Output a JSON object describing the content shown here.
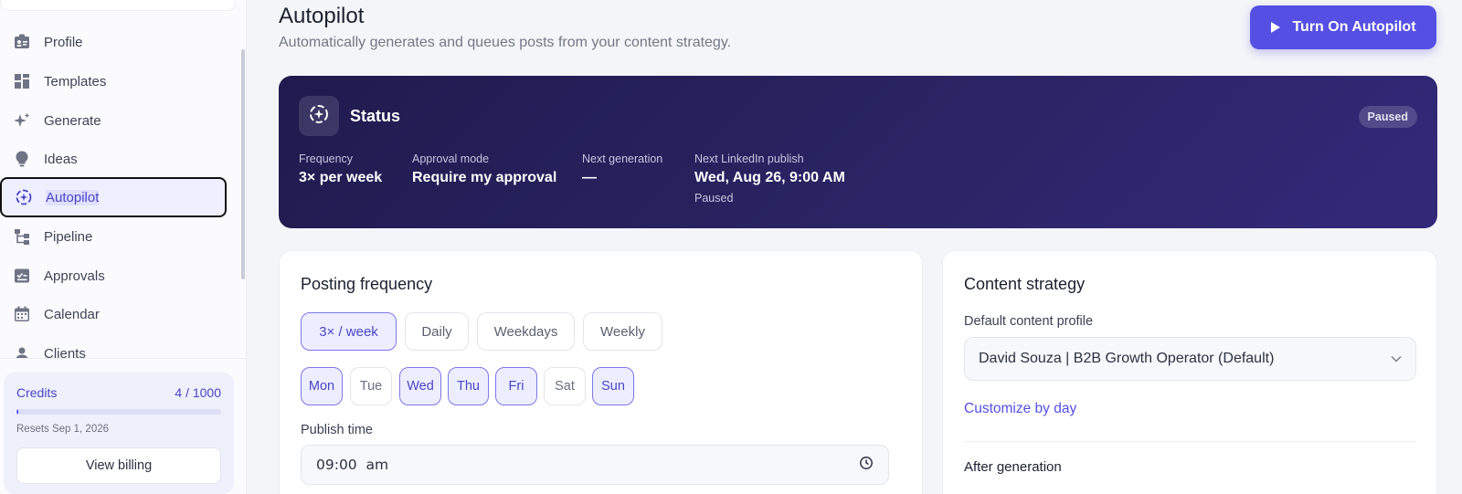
{
  "sidebar": {
    "items": [
      {
        "label": "Profile",
        "icon": "profile-card-icon"
      },
      {
        "label": "Templates",
        "icon": "templates-grid-icon"
      },
      {
        "label": "Generate",
        "icon": "sparkles-icon"
      },
      {
        "label": "Ideas",
        "icon": "lightbulb-icon"
      },
      {
        "label": "Autopilot",
        "icon": "autopilot-icon",
        "active": true
      },
      {
        "label": "Pipeline",
        "icon": "pipeline-icon"
      },
      {
        "label": "Approvals",
        "icon": "approvals-check-icon"
      },
      {
        "label": "Calendar",
        "icon": "calendar-icon"
      },
      {
        "label": "Clients",
        "icon": "clients-icon"
      }
    ],
    "credits": {
      "title": "Credits",
      "count": "4 / 1000",
      "used_fraction": 0.004,
      "resets": "Resets Sep 1, 2026",
      "billing_label": "View billing"
    }
  },
  "header": {
    "title": "Autopilot",
    "subtitle": "Automatically generates and queues posts from your content strategy.",
    "turn_on_label": "Turn On Autopilot"
  },
  "status": {
    "title": "Status",
    "badge": "Paused",
    "frequency_label": "Frequency",
    "frequency_value": "3× per week",
    "approval_label": "Approval mode",
    "approval_value": "Require my approval",
    "next_gen_label": "Next generation",
    "next_gen_value": "—",
    "next_publish_label": "Next LinkedIn publish",
    "next_publish_value": "Wed, Aug 26, 9:00 AM",
    "next_publish_sub": "Paused"
  },
  "posting": {
    "title": "Posting frequency",
    "options": [
      "3× / week",
      "Daily",
      "Weekdays",
      "Weekly"
    ],
    "selected_option": "3× / week",
    "days": [
      "Mon",
      "Tue",
      "Wed",
      "Thu",
      "Fri",
      "Sat",
      "Sun"
    ],
    "selected_days": [
      "Mon",
      "Wed",
      "Thu",
      "Fri",
      "Sun"
    ],
    "publish_time_label": "Publish time",
    "publish_time_value": "09:00  am"
  },
  "strategy": {
    "title": "Content strategy",
    "profile_label": "Default content profile",
    "profile_value": "David Souza | B2B Growth Operator (Default)",
    "customize_link": "Customize by day",
    "after_generation_label": "After generation"
  },
  "colors": {
    "accent": "#554fe4",
    "status_bg": "#2a2464"
  }
}
